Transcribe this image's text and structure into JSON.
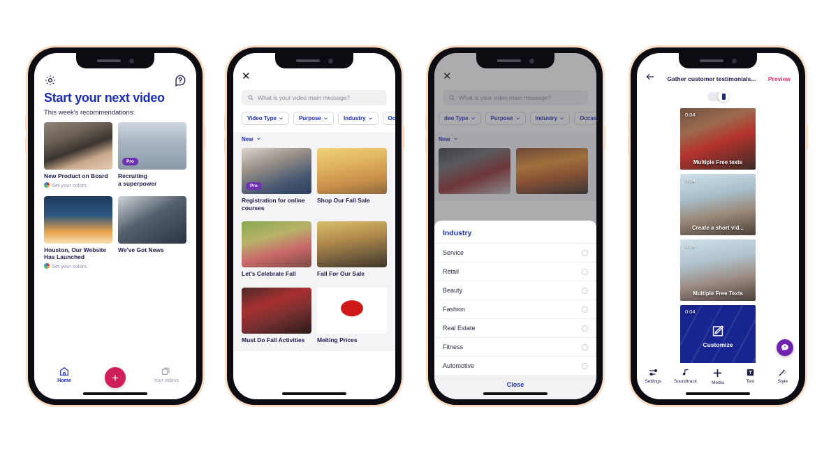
{
  "theme": {
    "brand_blue": "#1a2bb5",
    "ink": "#1c1c4a",
    "pink": "#cf1f5a",
    "preview_pink": "#e0306b",
    "purple": "#6f32b0",
    "help_purple": "#6f21b0"
  },
  "phone1": {
    "icons": {
      "settings": "gear-icon",
      "help": "help-circle-icon"
    },
    "title": "Start your next video",
    "subtitle": "This week's recommendations:",
    "cards": [
      {
        "title": "New Product on Board",
        "sub": "Set your colors",
        "pro": false
      },
      {
        "title": "Recruiting\na superpower",
        "sub": "",
        "pro": true,
        "pro_label": "Pro"
      },
      {
        "title": "Houston, Our Website Has Launched",
        "sub": "Set your colors",
        "pro": false
      },
      {
        "title": "We've Got News",
        "sub": "",
        "pro": false
      }
    ],
    "nav": {
      "home_label": "Home",
      "create_label": "+",
      "videos_label": "Your videos"
    }
  },
  "phone2": {
    "close_label": "✕",
    "search": {
      "placeholder": "What is your video main message?",
      "value": "",
      "icon": "search-icon"
    },
    "chips": [
      {
        "label": "Video Type"
      },
      {
        "label": "Purpose"
      },
      {
        "label": "Industry"
      },
      {
        "label": "Occasion"
      }
    ],
    "sort_label": "New",
    "cards": [
      {
        "title": "Registration for online courses",
        "pro": true,
        "pro_label": "Pro"
      },
      {
        "title": "Shop Our Fall Sale",
        "pro": false
      },
      {
        "title": "Let's Celebrate Fall",
        "pro": false
      },
      {
        "title": "Fall For Our Sale",
        "pro": false
      },
      {
        "title": "Must Do Fall Activities",
        "pro": false
      },
      {
        "title": "Melting Prices",
        "pro": false
      }
    ]
  },
  "phone3": {
    "close_label": "✕",
    "search": {
      "placeholder": "What is your video main message?",
      "value": "",
      "icon": "search-icon"
    },
    "chips": [
      {
        "label": "deo Type"
      },
      {
        "label": "Purpose"
      },
      {
        "label": "Industry"
      },
      {
        "label": "Occasion"
      }
    ],
    "sort_label": "New",
    "sheet": {
      "title": "Industry",
      "options": [
        {
          "label": "Service",
          "selected": false
        },
        {
          "label": "Retail",
          "selected": false
        },
        {
          "label": "Beauty",
          "selected": false
        },
        {
          "label": "Fashion",
          "selected": false
        },
        {
          "label": "Real Estate",
          "selected": false
        },
        {
          "label": "Fitness",
          "selected": false
        },
        {
          "label": "Automotive",
          "selected": false
        }
      ],
      "close_label": "Close"
    }
  },
  "phone4": {
    "back_icon": "arrow-left-icon",
    "title": "Gather customer testimonials...",
    "preview_label": "Preview",
    "scenes": [
      {
        "duration": "0:04",
        "caption": "Multiple Free texts"
      },
      {
        "duration": "0:04",
        "caption": "Create a short vid..."
      },
      {
        "duration": "0:04",
        "caption": "Multiple Free Texts"
      },
      {
        "duration": "0:04",
        "caption": "Customize",
        "type": "customize"
      }
    ],
    "help_icon": "help-chat-icon",
    "toolbar": [
      {
        "label": "Settings",
        "icon": "sliders-icon"
      },
      {
        "label": "Soundtrack",
        "icon": "music-note-icon"
      },
      {
        "label": "Media",
        "icon": "plus-icon"
      },
      {
        "label": "Text",
        "icon": "text-box-icon"
      },
      {
        "label": "Style",
        "icon": "magic-wand-icon"
      }
    ]
  }
}
